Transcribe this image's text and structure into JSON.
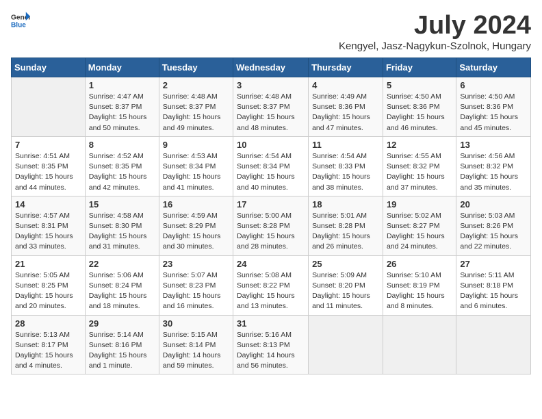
{
  "logo": {
    "text_general": "General",
    "text_blue": "Blue"
  },
  "title": "July 2024",
  "location": "Kengyel, Jasz-Nagykun-Szolnok, Hungary",
  "headers": [
    "Sunday",
    "Monday",
    "Tuesday",
    "Wednesday",
    "Thursday",
    "Friday",
    "Saturday"
  ],
  "weeks": [
    [
      {
        "day": "",
        "sunrise": "",
        "sunset": "",
        "daylight": ""
      },
      {
        "day": "1",
        "sunrise": "Sunrise: 4:47 AM",
        "sunset": "Sunset: 8:37 PM",
        "daylight": "Daylight: 15 hours and 50 minutes."
      },
      {
        "day": "2",
        "sunrise": "Sunrise: 4:48 AM",
        "sunset": "Sunset: 8:37 PM",
        "daylight": "Daylight: 15 hours and 49 minutes."
      },
      {
        "day": "3",
        "sunrise": "Sunrise: 4:48 AM",
        "sunset": "Sunset: 8:37 PM",
        "daylight": "Daylight: 15 hours and 48 minutes."
      },
      {
        "day": "4",
        "sunrise": "Sunrise: 4:49 AM",
        "sunset": "Sunset: 8:36 PM",
        "daylight": "Daylight: 15 hours and 47 minutes."
      },
      {
        "day": "5",
        "sunrise": "Sunrise: 4:50 AM",
        "sunset": "Sunset: 8:36 PM",
        "daylight": "Daylight: 15 hours and 46 minutes."
      },
      {
        "day": "6",
        "sunrise": "Sunrise: 4:50 AM",
        "sunset": "Sunset: 8:36 PM",
        "daylight": "Daylight: 15 hours and 45 minutes."
      }
    ],
    [
      {
        "day": "7",
        "sunrise": "Sunrise: 4:51 AM",
        "sunset": "Sunset: 8:35 PM",
        "daylight": "Daylight: 15 hours and 44 minutes."
      },
      {
        "day": "8",
        "sunrise": "Sunrise: 4:52 AM",
        "sunset": "Sunset: 8:35 PM",
        "daylight": "Daylight: 15 hours and 42 minutes."
      },
      {
        "day": "9",
        "sunrise": "Sunrise: 4:53 AM",
        "sunset": "Sunset: 8:34 PM",
        "daylight": "Daylight: 15 hours and 41 minutes."
      },
      {
        "day": "10",
        "sunrise": "Sunrise: 4:54 AM",
        "sunset": "Sunset: 8:34 PM",
        "daylight": "Daylight: 15 hours and 40 minutes."
      },
      {
        "day": "11",
        "sunrise": "Sunrise: 4:54 AM",
        "sunset": "Sunset: 8:33 PM",
        "daylight": "Daylight: 15 hours and 38 minutes."
      },
      {
        "day": "12",
        "sunrise": "Sunrise: 4:55 AM",
        "sunset": "Sunset: 8:32 PM",
        "daylight": "Daylight: 15 hours and 37 minutes."
      },
      {
        "day": "13",
        "sunrise": "Sunrise: 4:56 AM",
        "sunset": "Sunset: 8:32 PM",
        "daylight": "Daylight: 15 hours and 35 minutes."
      }
    ],
    [
      {
        "day": "14",
        "sunrise": "Sunrise: 4:57 AM",
        "sunset": "Sunset: 8:31 PM",
        "daylight": "Daylight: 15 hours and 33 minutes."
      },
      {
        "day": "15",
        "sunrise": "Sunrise: 4:58 AM",
        "sunset": "Sunset: 8:30 PM",
        "daylight": "Daylight: 15 hours and 31 minutes."
      },
      {
        "day": "16",
        "sunrise": "Sunrise: 4:59 AM",
        "sunset": "Sunset: 8:29 PM",
        "daylight": "Daylight: 15 hours and 30 minutes."
      },
      {
        "day": "17",
        "sunrise": "Sunrise: 5:00 AM",
        "sunset": "Sunset: 8:28 PM",
        "daylight": "Daylight: 15 hours and 28 minutes."
      },
      {
        "day": "18",
        "sunrise": "Sunrise: 5:01 AM",
        "sunset": "Sunset: 8:28 PM",
        "daylight": "Daylight: 15 hours and 26 minutes."
      },
      {
        "day": "19",
        "sunrise": "Sunrise: 5:02 AM",
        "sunset": "Sunset: 8:27 PM",
        "daylight": "Daylight: 15 hours and 24 minutes."
      },
      {
        "day": "20",
        "sunrise": "Sunrise: 5:03 AM",
        "sunset": "Sunset: 8:26 PM",
        "daylight": "Daylight: 15 hours and 22 minutes."
      }
    ],
    [
      {
        "day": "21",
        "sunrise": "Sunrise: 5:05 AM",
        "sunset": "Sunset: 8:25 PM",
        "daylight": "Daylight: 15 hours and 20 minutes."
      },
      {
        "day": "22",
        "sunrise": "Sunrise: 5:06 AM",
        "sunset": "Sunset: 8:24 PM",
        "daylight": "Daylight: 15 hours and 18 minutes."
      },
      {
        "day": "23",
        "sunrise": "Sunrise: 5:07 AM",
        "sunset": "Sunset: 8:23 PM",
        "daylight": "Daylight: 15 hours and 16 minutes."
      },
      {
        "day": "24",
        "sunrise": "Sunrise: 5:08 AM",
        "sunset": "Sunset: 8:22 PM",
        "daylight": "Daylight: 15 hours and 13 minutes."
      },
      {
        "day": "25",
        "sunrise": "Sunrise: 5:09 AM",
        "sunset": "Sunset: 8:20 PM",
        "daylight": "Daylight: 15 hours and 11 minutes."
      },
      {
        "day": "26",
        "sunrise": "Sunrise: 5:10 AM",
        "sunset": "Sunset: 8:19 PM",
        "daylight": "Daylight: 15 hours and 8 minutes."
      },
      {
        "day": "27",
        "sunrise": "Sunrise: 5:11 AM",
        "sunset": "Sunset: 8:18 PM",
        "daylight": "Daylight: 15 hours and 6 minutes."
      }
    ],
    [
      {
        "day": "28",
        "sunrise": "Sunrise: 5:13 AM",
        "sunset": "Sunset: 8:17 PM",
        "daylight": "Daylight: 15 hours and 4 minutes."
      },
      {
        "day": "29",
        "sunrise": "Sunrise: 5:14 AM",
        "sunset": "Sunset: 8:16 PM",
        "daylight": "Daylight: 15 hours and 1 minute."
      },
      {
        "day": "30",
        "sunrise": "Sunrise: 5:15 AM",
        "sunset": "Sunset: 8:14 PM",
        "daylight": "Daylight: 14 hours and 59 minutes."
      },
      {
        "day": "31",
        "sunrise": "Sunrise: 5:16 AM",
        "sunset": "Sunset: 8:13 PM",
        "daylight": "Daylight: 14 hours and 56 minutes."
      },
      {
        "day": "",
        "sunrise": "",
        "sunset": "",
        "daylight": ""
      },
      {
        "day": "",
        "sunrise": "",
        "sunset": "",
        "daylight": ""
      },
      {
        "day": "",
        "sunrise": "",
        "sunset": "",
        "daylight": ""
      }
    ]
  ]
}
